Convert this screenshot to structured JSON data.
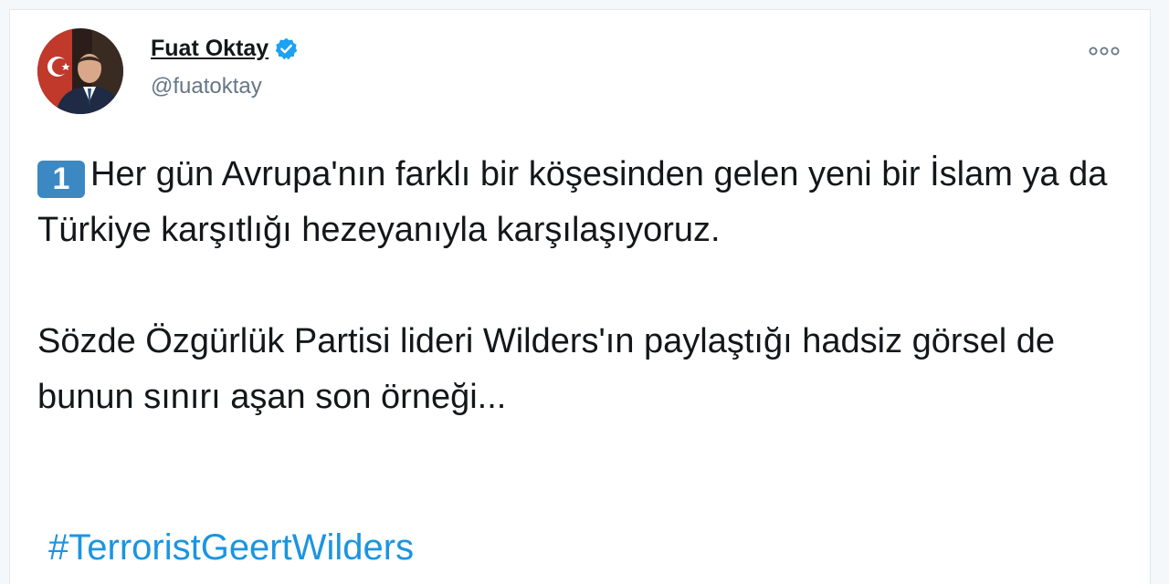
{
  "tweet": {
    "author": {
      "display_name": "Fuat Oktay",
      "handle": "@fuatoktay",
      "verified": true
    },
    "more_icon": "ellipsis-icon",
    "number_emoji": "1",
    "paragraphs": [
      "Her gün Avrupa'nın farklı bir köşesinden gelen yeni bir İslam ya da Türkiye karşıtlığı hezeyanıyla karşılaşıyoruz.",
      "Sözde Özgürlük Partisi lideri Wilders'ın paylaştığı hadsiz görsel de bunun sınırı aşan son örneği..."
    ],
    "hashtag": "#TerroristGeertWilders"
  },
  "colors": {
    "text": "#14171a",
    "secondary": "#657786",
    "verified": "#1da1f2",
    "hashtag": "#1b95e0",
    "keycap": "#3b88c3"
  }
}
